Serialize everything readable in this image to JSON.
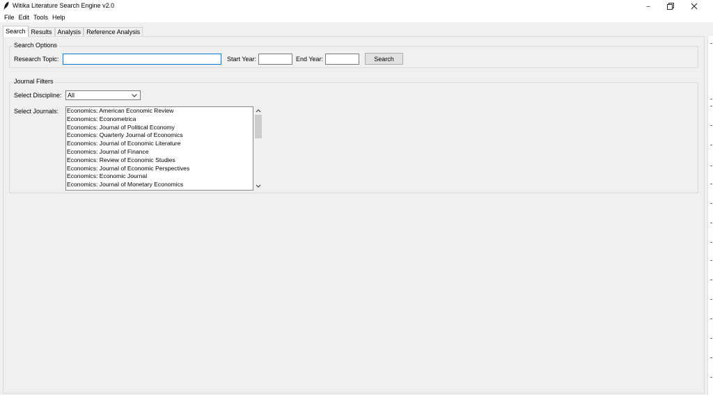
{
  "window": {
    "title": "Witika Literature Search Engine v2.0",
    "controls": {
      "minimize": "–",
      "restore": "❐",
      "close": "✕"
    }
  },
  "menu": [
    "File",
    "Edit",
    "Tools",
    "Help"
  ],
  "tabs": [
    {
      "label": "Search",
      "active": true
    },
    {
      "label": "Results",
      "active": false
    },
    {
      "label": "Analysis",
      "active": false
    },
    {
      "label": "Reference Analysis",
      "active": false
    }
  ],
  "search_options": {
    "title": "Search Options",
    "research_topic_label": "Research Topic:",
    "research_topic_value": "",
    "start_year_label": "Start Year:",
    "start_year_value": "",
    "end_year_label": "End Year:",
    "end_year_value": "",
    "search_button": "Search"
  },
  "journal_filters": {
    "title": "Journal Filters",
    "discipline_label": "Select Discipline:",
    "discipline_value": "All",
    "journals_label": "Select Journals:",
    "journals": [
      "Economics: American Economic Review",
      "Economics: Econometrica",
      "Economics: Journal of Political Economy",
      "Economics: Quarterly Journal of Economics",
      "Economics: Journal of Economic Literature",
      "Economics: Journal of Finance",
      "Economics: Review of Economic Studies",
      "Economics: Journal of Economic Perspectives",
      "Economics: Economic Journal",
      "Economics: Journal of Monetary Economics"
    ]
  },
  "icons": {
    "app": "feather-icon",
    "dropdown": "chevron-down-icon",
    "scroll_up": "scroll-up-icon",
    "scroll_down": "scroll-down-icon"
  }
}
